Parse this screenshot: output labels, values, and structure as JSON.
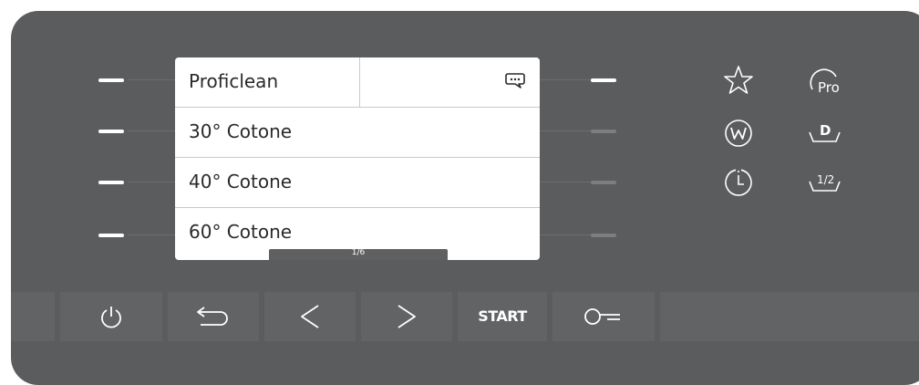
{
  "display": {
    "programs": [
      "Proficlean",
      "30° Cotone",
      "40° Cotone",
      "60° Cotone"
    ],
    "page_indicator": "1/6"
  },
  "function_icons": [
    "star-icon",
    "pro-icon",
    "w-icon",
    "d-icon",
    "timer-icon",
    "half-load-icon"
  ],
  "buttons": {
    "power": "power-icon",
    "back": "back-arrow-icon",
    "left": "chevron-left-icon",
    "right": "chevron-right-icon",
    "start_label": "START",
    "lock": "key-lock-icon"
  },
  "colors": {
    "panel": "#5b5c5e",
    "button": "#626365",
    "display": "#ffffff",
    "indicator_on": "#ffffff",
    "indicator_off": "#7d7e80"
  }
}
